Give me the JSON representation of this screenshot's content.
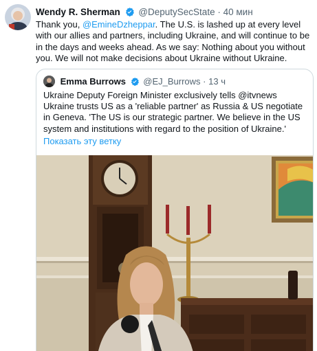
{
  "tweet": {
    "author_name": "Wendy R. Sherman",
    "handle": "@DeputySecState",
    "separator": "·",
    "time": "40 мин",
    "text_pre": "Thank you, ",
    "mention": "@EmineDzheppar",
    "text_post": ". The U.S. is lashed up at every level with our allies and partners, including Ukraine, and will continue to be in the days and weeks ahead. As we say: Nothing about you without you. We will not make decisions about Ukraine without Ukraine."
  },
  "quoted": {
    "author_name": "Emma Burrows",
    "handle": "@EJ_Burrows",
    "separator": "·",
    "time": "13 ч",
    "text": "Ukraine Deputy Foreign Minister exclusively tells @itvnews Ukraine trusts US as a 'reliable partner' as Russia & US negotiate in Geneva. 'The US is our strategic partner. We believe in the US system and institutions with regard to the position of Ukraine.'",
    "show_thread": "Показать эту ветку"
  },
  "colors": {
    "link": "#1d9bf0",
    "secondary_text": "#536471",
    "verified_badge": "#1d9bf0",
    "border": "#cfd9de"
  },
  "icons": [
    "verified-badge-icon",
    "avatar"
  ]
}
